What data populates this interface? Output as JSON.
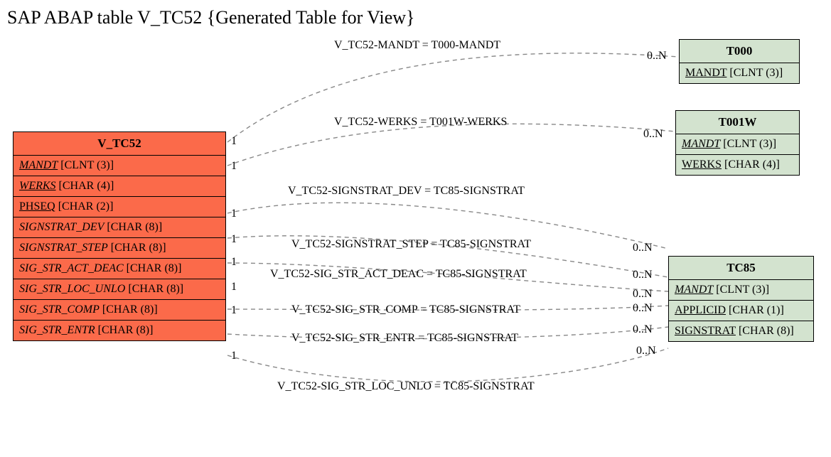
{
  "title": "SAP ABAP table V_TC52 {Generated Table for View}",
  "tables": {
    "vtc52": {
      "name": "V_TC52",
      "fields": [
        {
          "name": "MANDT",
          "type": "CLNT (3)",
          "style": "fk"
        },
        {
          "name": "WERKS",
          "type": "CHAR (4)",
          "style": "fk"
        },
        {
          "name": "PHSEQ",
          "type": "CHAR (2)",
          "style": "pk"
        },
        {
          "name": "SIGNSTRAT_DEV",
          "type": "CHAR (8)",
          "style": "italic"
        },
        {
          "name": "SIGNSTRAT_STEP",
          "type": "CHAR (8)",
          "style": "italic"
        },
        {
          "name": "SIG_STR_ACT_DEAC",
          "type": "CHAR (8)",
          "style": "italic"
        },
        {
          "name": "SIG_STR_LOC_UNLO",
          "type": "CHAR (8)",
          "style": "italic"
        },
        {
          "name": "SIG_STR_COMP",
          "type": "CHAR (8)",
          "style": "italic"
        },
        {
          "name": "SIG_STR_ENTR",
          "type": "CHAR (8)",
          "style": "italic"
        }
      ]
    },
    "t000": {
      "name": "T000",
      "fields": [
        {
          "name": "MANDT",
          "type": "CLNT (3)",
          "style": "pk"
        }
      ]
    },
    "t001w": {
      "name": "T001W",
      "fields": [
        {
          "name": "MANDT",
          "type": "CLNT (3)",
          "style": "fk"
        },
        {
          "name": "WERKS",
          "type": "CHAR (4)",
          "style": "pk"
        }
      ]
    },
    "tc85": {
      "name": "TC85",
      "fields": [
        {
          "name": "MANDT",
          "type": "CLNT (3)",
          "style": "fk"
        },
        {
          "name": "APPLICID",
          "type": "CHAR (1)",
          "style": "pk"
        },
        {
          "name": "SIGNSTRAT",
          "type": "CHAR (8)",
          "style": "pk"
        }
      ]
    }
  },
  "relations": [
    {
      "label": "V_TC52-MANDT = T000-MANDT",
      "left": "1",
      "right": "0..N"
    },
    {
      "label": "V_TC52-WERKS = T001W-WERKS",
      "left": "1",
      "right": "0..N"
    },
    {
      "label": "V_TC52-SIGNSTRAT_DEV = TC85-SIGNSTRAT",
      "left": "1",
      "right": "0..N"
    },
    {
      "label": "V_TC52-SIGNSTRAT_STEP = TC85-SIGNSTRAT",
      "left": "1",
      "right": "0..N"
    },
    {
      "label": "V_TC52-SIG_STR_ACT_DEAC = TC85-SIGNSTRAT",
      "left": "1",
      "right": "0..N"
    },
    {
      "label": "V_TC52-SIG_STR_COMP = TC85-SIGNSTRAT",
      "left": "1",
      "right": "0..N"
    },
    {
      "label": "V_TC52-SIG_STR_ENTR = TC85-SIGNSTRAT",
      "left": "1",
      "right": "0..N"
    },
    {
      "label": "V_TC52-SIG_STR_LOC_UNLO = TC85-SIGNSTRAT",
      "left": "1",
      "right": "0..N"
    }
  ]
}
